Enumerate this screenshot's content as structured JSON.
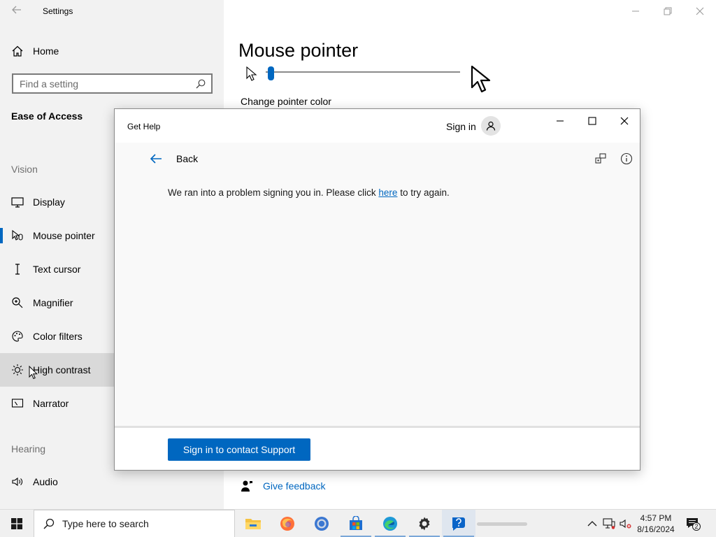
{
  "settings": {
    "app_title": "Settings",
    "home_label": "Home",
    "search_placeholder": "Find a setting",
    "section_title": "Ease of Access",
    "groups": {
      "vision": "Vision",
      "hearing": "Hearing"
    },
    "nav": {
      "display": "Display",
      "mouse_pointer": "Mouse pointer",
      "text_cursor": "Text cursor",
      "magnifier": "Magnifier",
      "color_filters": "Color filters",
      "high_contrast": "High contrast",
      "narrator": "Narrator",
      "audio": "Audio"
    },
    "page_title": "Mouse pointer",
    "pointer_size_level": 0.02,
    "change_pointer_color": "Change pointer color",
    "give_feedback": "Give feedback"
  },
  "dialog": {
    "title": "Get Help",
    "sign_in": "Sign in",
    "back": "Back",
    "message_before": "We ran into a problem signing you in. Please click ",
    "message_link": "here",
    "message_after": " to try again.",
    "contact_button": "Sign in to contact Support"
  },
  "taskbar": {
    "search_placeholder": "Type here to search",
    "time": "4:57 PM",
    "date": "8/16/2024",
    "notification_count": "2"
  },
  "colors": {
    "accent": "#0067c0",
    "sidebar_bg": "#f2f2f2",
    "hover_bg": "#d9d9d9"
  }
}
